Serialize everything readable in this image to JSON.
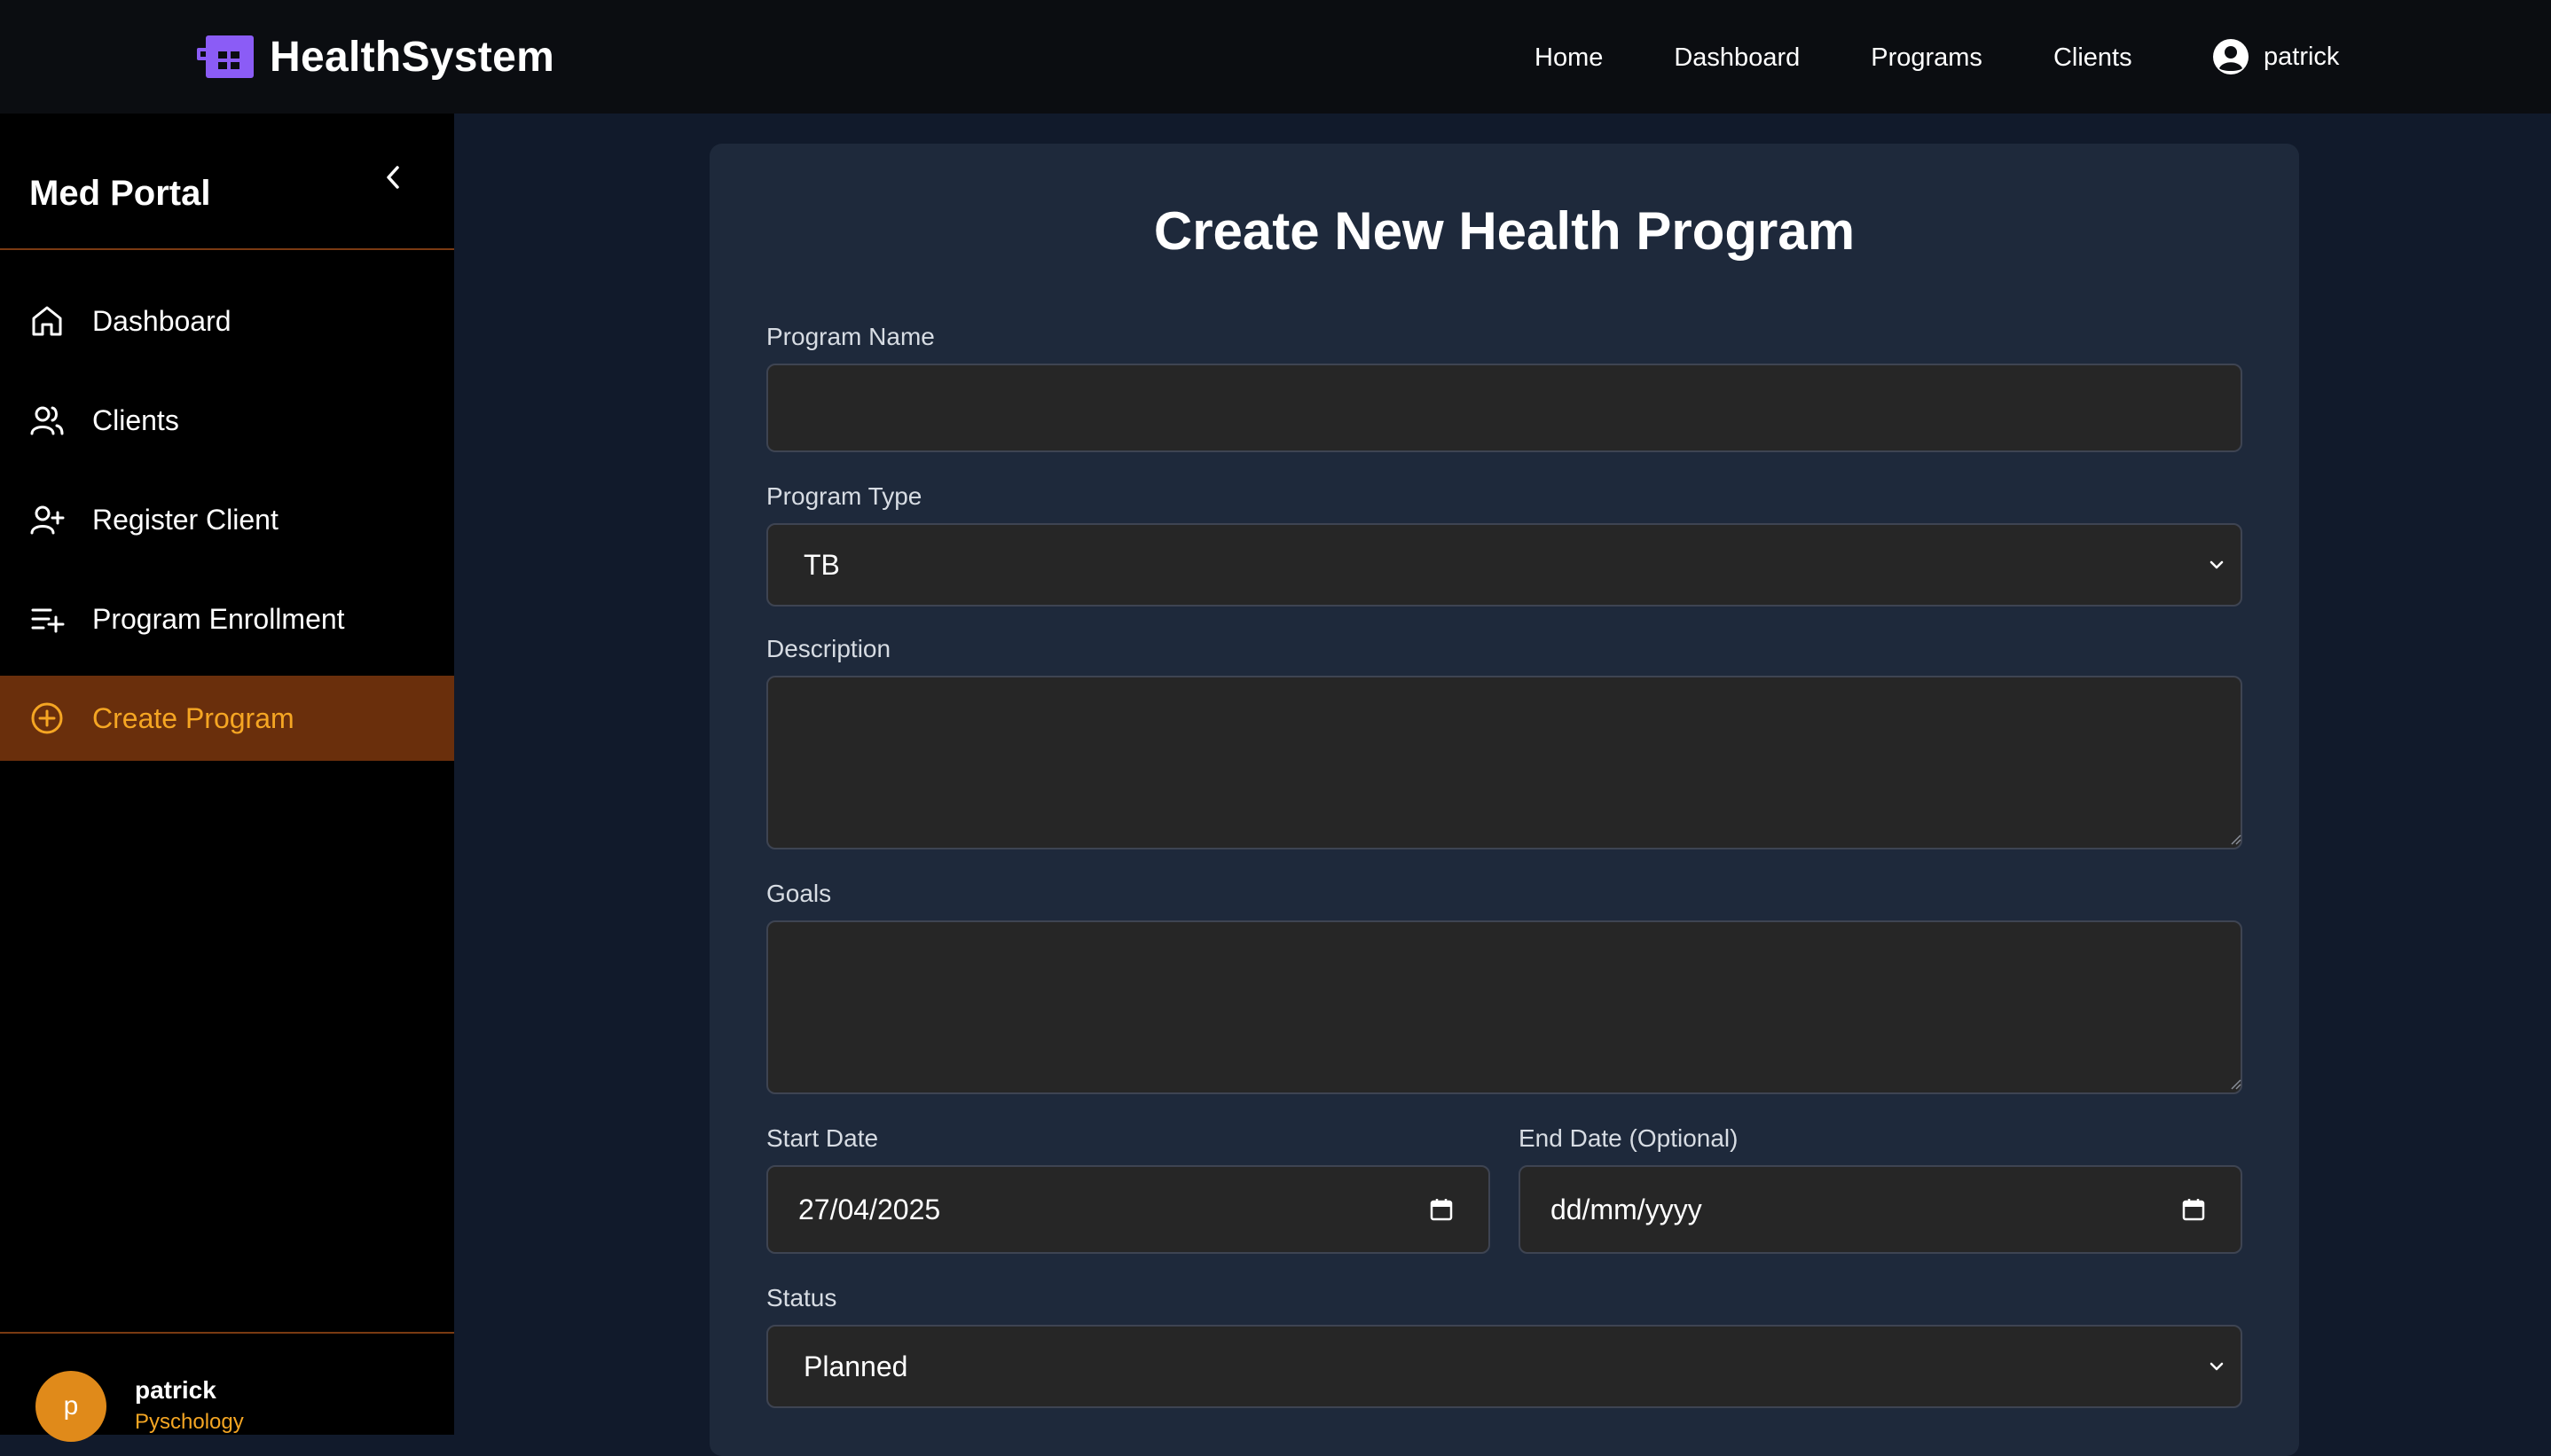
{
  "header": {
    "brand": "HealthSystem",
    "logo_icon": "puzzle-logo-icon",
    "logo_color": "#8b5cf6",
    "nav": [
      "Home",
      "Dashboard",
      "Programs",
      "Clients"
    ],
    "user": "patrick"
  },
  "sidebar": {
    "title": "Med Portal",
    "collapse_icon": "chevron-left-icon",
    "items": [
      {
        "label": "Dashboard",
        "icon": "home-icon",
        "active": false
      },
      {
        "label": "Clients",
        "icon": "users-icon",
        "active": false
      },
      {
        "label": "Register Client",
        "icon": "user-plus-icon",
        "active": false
      },
      {
        "label": "Program Enrollment",
        "icon": "list-plus-icon",
        "active": false
      },
      {
        "label": "Create Program",
        "icon": "plus-circle-icon",
        "active": true
      }
    ],
    "footer": {
      "avatar_initial": "p",
      "name": "patrick",
      "role": "Pyschology"
    },
    "accent_color": "#f5a623"
  },
  "form": {
    "title": "Create New Health Program",
    "program_name": {
      "label": "Program Name",
      "value": ""
    },
    "program_type": {
      "label": "Program Type",
      "value": "TB"
    },
    "description": {
      "label": "Description",
      "value": ""
    },
    "goals": {
      "label": "Goals",
      "value": ""
    },
    "start_date": {
      "label": "Start Date",
      "value": "27/04/2025"
    },
    "end_date": {
      "label": "End Date (Optional)",
      "value": "dd/mm/yyyy"
    },
    "status": {
      "label": "Status",
      "value": "Planned"
    }
  }
}
